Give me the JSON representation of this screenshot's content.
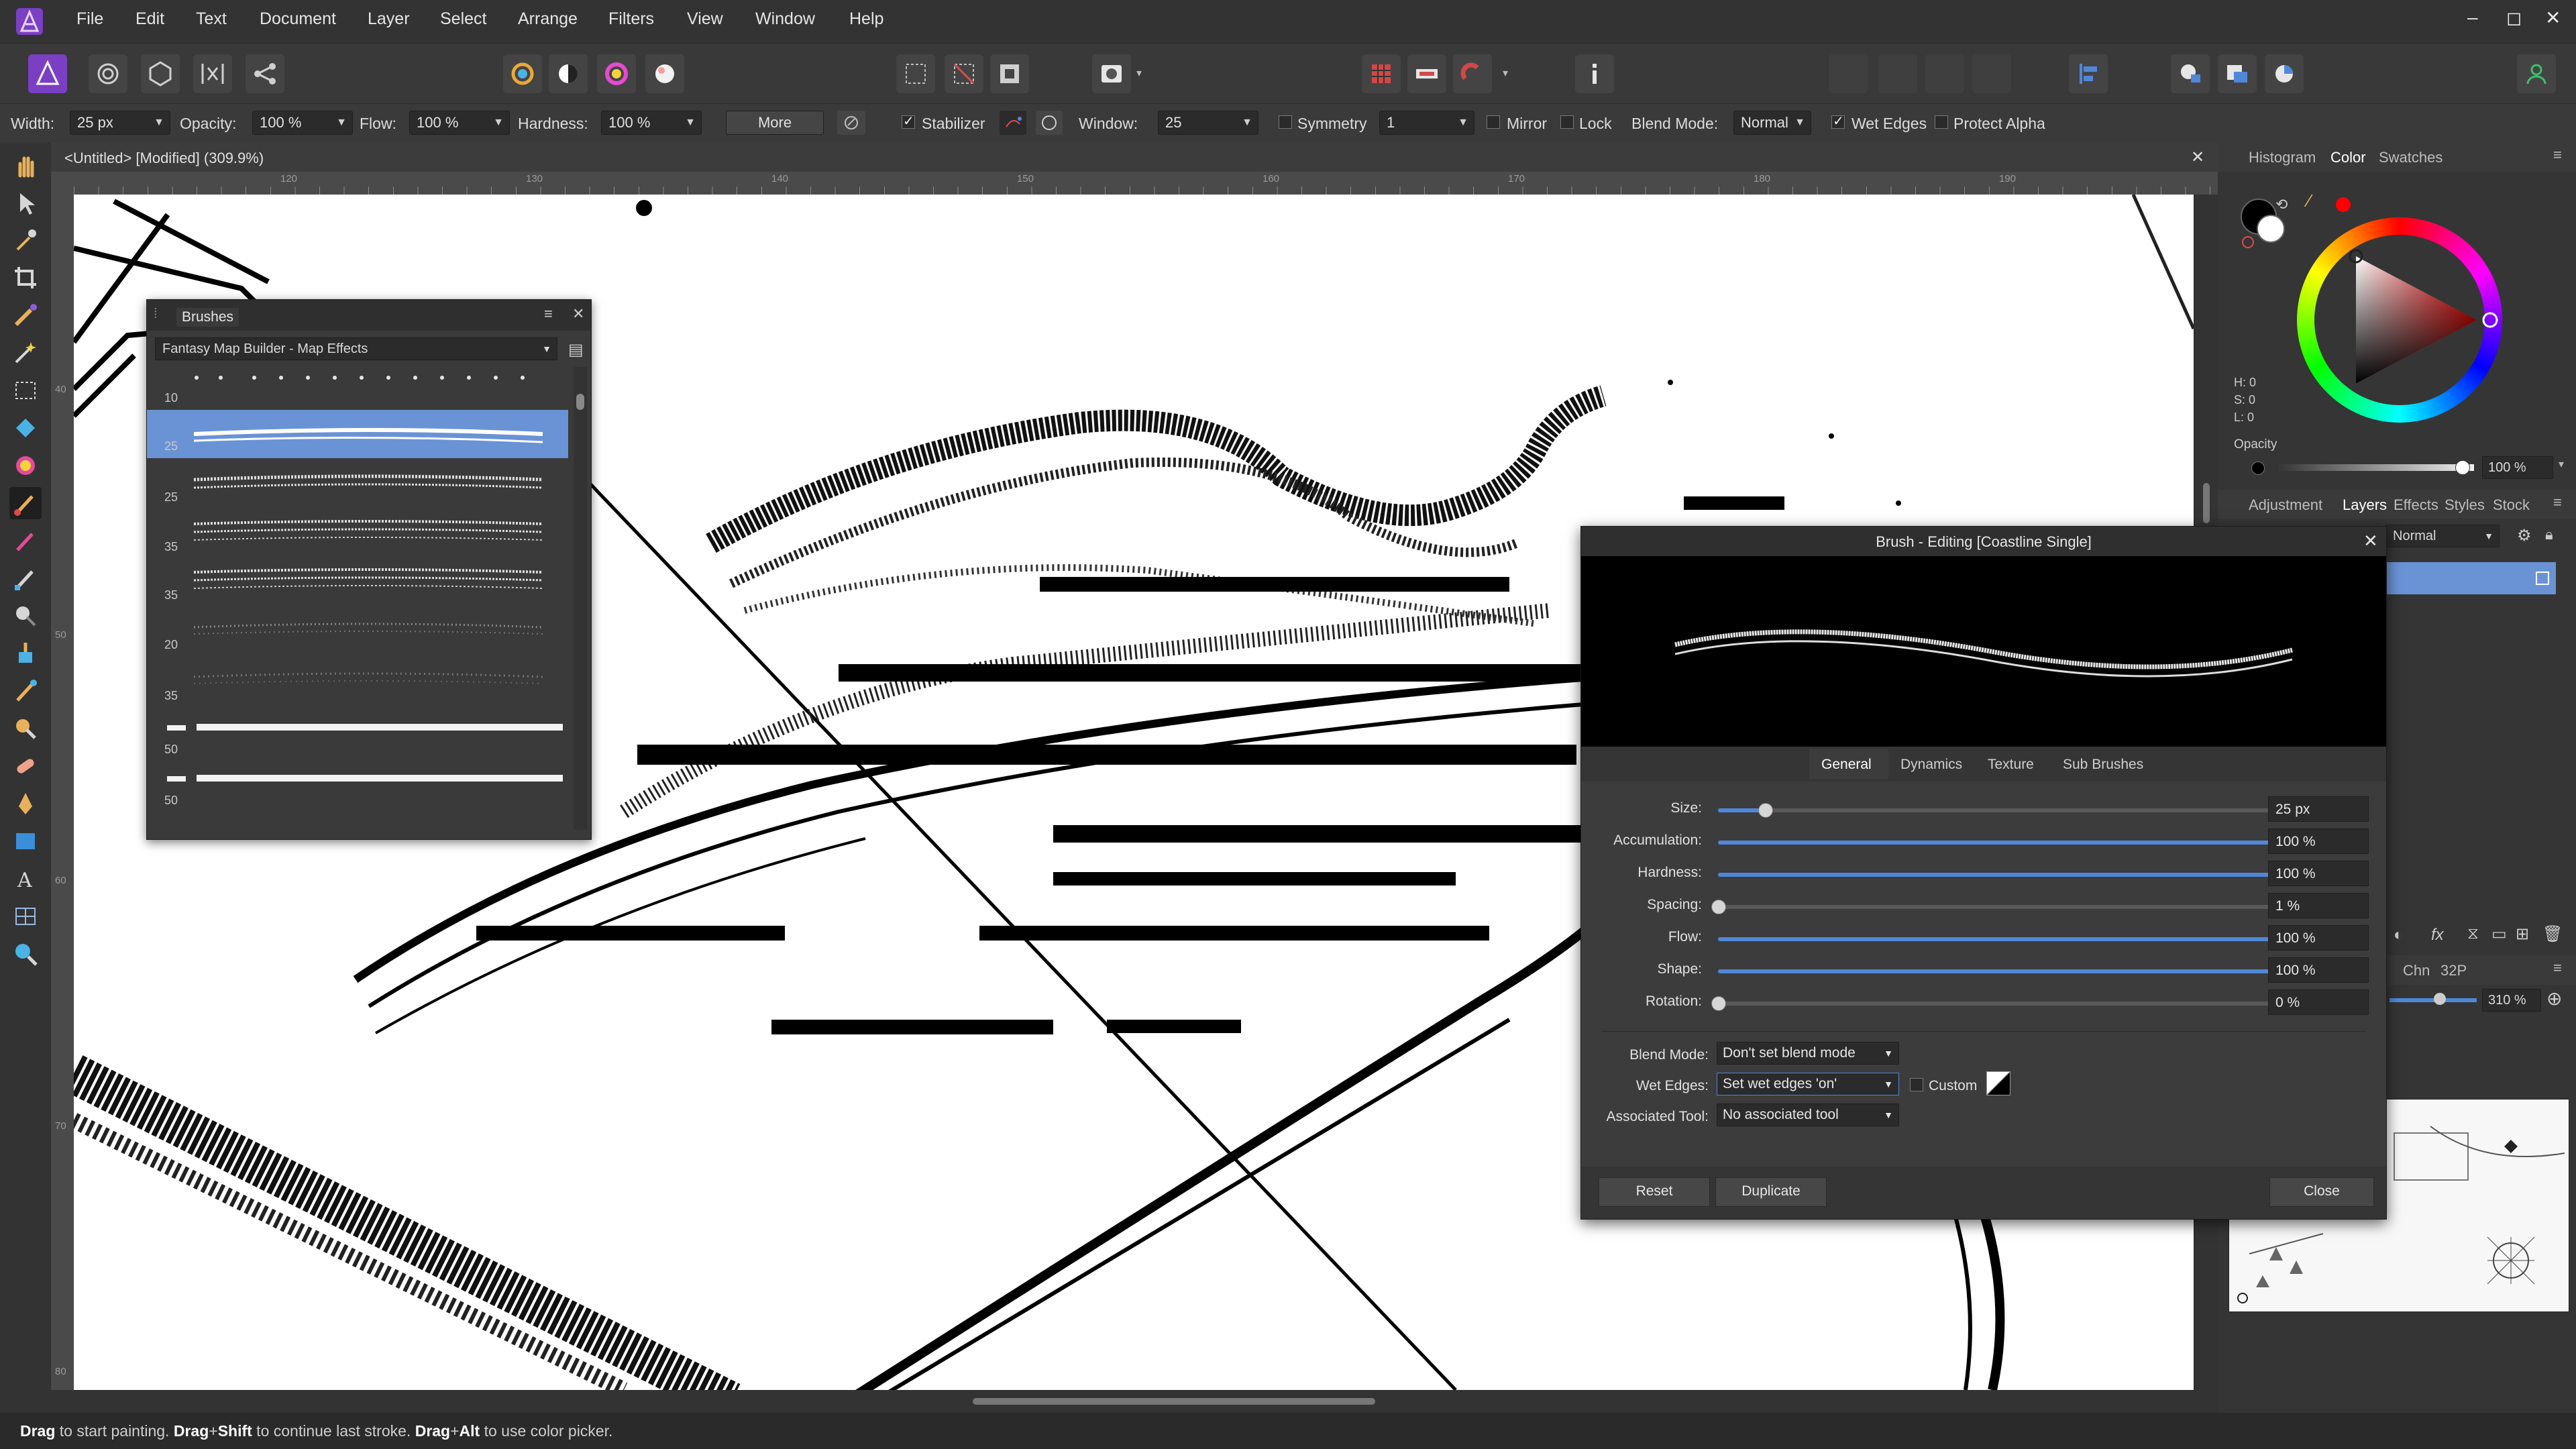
{
  "menubar": {
    "items": [
      "File",
      "Edit",
      "Text",
      "Document",
      "Layer",
      "Select",
      "Arrange",
      "Filters",
      "View",
      "Window",
      "Help"
    ],
    "window_controls": [
      "–",
      "◻",
      "✕"
    ]
  },
  "context_bar": {
    "width_label": "Width:",
    "width_value": "25 px",
    "opacity_label": "Opacity:",
    "opacity_value": "100 %",
    "flow_label": "Flow:",
    "flow_value": "100 %",
    "hardness_label": "Hardness:",
    "hardness_value": "100 %",
    "more_label": "More",
    "stabilizer_label": "Stabilizer",
    "stabilizer_checked": true,
    "window_label": "Window:",
    "window_value": "25",
    "symmetry_label": "Symmetry",
    "symmetry_value": "1",
    "mirror_label": "Mirror",
    "lock_label": "Lock",
    "blend_label": "Blend Mode:",
    "blend_value": "Normal",
    "wet_edges_label": "Wet Edges",
    "wet_edges_checked": true,
    "protect_alpha_label": "Protect Alpha"
  },
  "document": {
    "tab_title": "<Untitled> [Modified] (309.9%)",
    "ruler_unit": "mm",
    "hruler_ticks": [
      "120",
      "130",
      "140",
      "150",
      "160",
      "170",
      "180",
      "190"
    ],
    "vruler_ticks": [
      "40",
      "50",
      "60",
      "70",
      "80"
    ]
  },
  "status": {
    "parts": [
      {
        "t": "Drag",
        "b": true
      },
      {
        "t": " to start painting. ",
        "b": false
      },
      {
        "t": "Drag",
        "b": true
      },
      {
        "t": "+",
        "b": false
      },
      {
        "t": "Shift",
        "b": true
      },
      {
        "t": " to continue last stroke. ",
        "b": false
      },
      {
        "t": "Drag",
        "b": true
      },
      {
        "t": "+",
        "b": false
      },
      {
        "t": "Alt",
        "b": true
      },
      {
        "t": " to use color picker.",
        "b": false
      }
    ]
  },
  "brushes_panel": {
    "title": "Brushes",
    "category": "Fantasy Map Builder - Map Effects",
    "rows": [
      {
        "size": "10",
        "style": "dots"
      },
      {
        "size": "25",
        "style": "double",
        "selected": true
      },
      {
        "size": "25",
        "style": "double"
      },
      {
        "size": "35",
        "style": "triple"
      },
      {
        "size": "35",
        "style": "triple"
      },
      {
        "size": "20",
        "style": "faint"
      },
      {
        "size": "35",
        "style": "faint"
      },
      {
        "size": "50",
        "style": "solid"
      },
      {
        "size": "50",
        "style": "solid"
      }
    ]
  },
  "right_panel": {
    "top_tabs": [
      "Histogram",
      "Color",
      "Swatches"
    ],
    "active_top_tab": "Color",
    "hsl": [
      "H: 0",
      "S: 0",
      "L: 0"
    ],
    "opacity_label": "Opacity",
    "opacity_value": "100 %",
    "mid_tabs": [
      "Adjustment",
      "Layers",
      "Effects",
      "Styles",
      "Stock"
    ],
    "active_mid_tab": "Layers",
    "layer_blend": "Normal",
    "nav_tabs": [
      "Chn",
      "32P"
    ],
    "zoom_value": "310 %"
  },
  "editor": {
    "title": "Brush - Editing [Coastline Single]",
    "tabs": [
      "General",
      "Dynamics",
      "Texture",
      "Sub Brushes"
    ],
    "active_tab": "General",
    "sliders": [
      {
        "label": "Size:",
        "value": "25 px",
        "fraction": 0.08
      },
      {
        "label": "Accumulation:",
        "value": "100 %",
        "fraction": 1.0
      },
      {
        "label": "Hardness:",
        "value": "100 %",
        "fraction": 1.0
      },
      {
        "label": "Spacing:",
        "value": "1 %",
        "fraction": 0.0
      },
      {
        "label": "Flow:",
        "value": "100 %",
        "fraction": 1.0
      },
      {
        "label": "Shape:",
        "value": "100 %",
        "fraction": 1.0
      },
      {
        "label": "Rotation:",
        "value": "0 %",
        "fraction": 0.0
      }
    ],
    "blend_label": "Blend Mode:",
    "blend_value": "Don't set blend mode",
    "wet_label": "Wet Edges:",
    "wet_value": "Set wet edges 'on'",
    "custom_label": "Custom",
    "assoc_label": "Associated Tool:",
    "assoc_value": "No associated tool",
    "reset_label": "Reset",
    "duplicate_label": "Duplicate",
    "close_label": "Close"
  },
  "colors": {
    "accent": "#4f88d8",
    "selection": "#6a93d6",
    "app_bg": "#2e2e2e",
    "canvas": "#ffffff"
  }
}
